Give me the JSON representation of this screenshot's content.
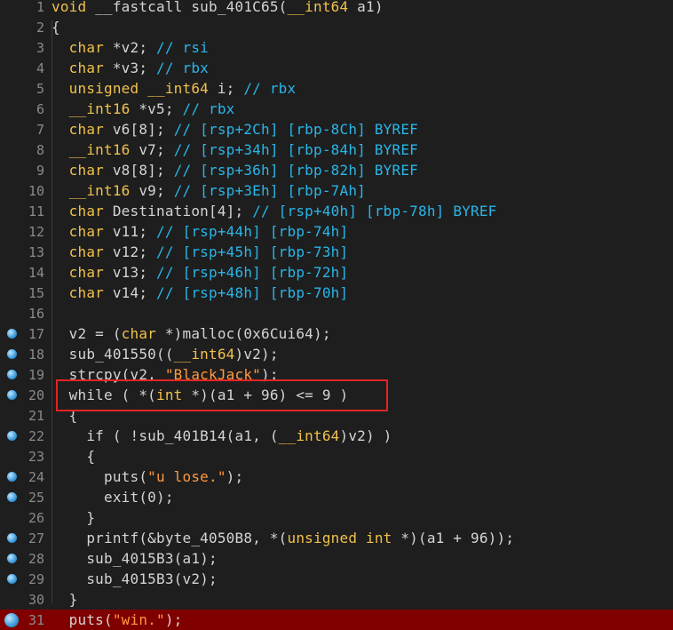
{
  "colors": {
    "background": "#1e1e1e",
    "line_number": "#8a8a8a",
    "type": "#f0c14b",
    "comment": "#29b6e8",
    "string": "#ff9940",
    "code": "#d4d4d4",
    "current_line": "#800000",
    "annotation_box": "#e32424",
    "breakpoint": "#3a9ad9"
  },
  "lines": [
    {
      "n": "1",
      "bp": false,
      "hl": false,
      "tokens": [
        [
          "ty",
          "void"
        ],
        [
          "pl",
          " __fastcall sub_401C65("
        ],
        [
          "ty",
          "__int64"
        ],
        [
          "pl",
          " a1)"
        ]
      ]
    },
    {
      "n": "2",
      "bp": false,
      "hl": false,
      "tokens": [
        [
          "pl",
          "{"
        ]
      ]
    },
    {
      "n": "3",
      "bp": false,
      "hl": false,
      "tokens": [
        [
          "pl",
          "  "
        ],
        [
          "ty",
          "char"
        ],
        [
          "pl",
          " *v2; "
        ],
        [
          "cm",
          "// rsi"
        ]
      ]
    },
    {
      "n": "4",
      "bp": false,
      "hl": false,
      "tokens": [
        [
          "pl",
          "  "
        ],
        [
          "ty",
          "char"
        ],
        [
          "pl",
          " *v3; "
        ],
        [
          "cm",
          "// rbx"
        ]
      ]
    },
    {
      "n": "5",
      "bp": false,
      "hl": false,
      "tokens": [
        [
          "pl",
          "  "
        ],
        [
          "ty",
          "unsigned __int64"
        ],
        [
          "pl",
          " i; "
        ],
        [
          "cm",
          "// rbx"
        ]
      ]
    },
    {
      "n": "6",
      "bp": false,
      "hl": false,
      "tokens": [
        [
          "pl",
          "  "
        ],
        [
          "ty",
          "__int16"
        ],
        [
          "pl",
          " *v5; "
        ],
        [
          "cm",
          "// rbx"
        ]
      ]
    },
    {
      "n": "7",
      "bp": false,
      "hl": false,
      "tokens": [
        [
          "pl",
          "  "
        ],
        [
          "ty",
          "char"
        ],
        [
          "pl",
          " v6[8]; "
        ],
        [
          "cm",
          "// [rsp+2Ch] [rbp-8Ch] BYREF"
        ]
      ]
    },
    {
      "n": "8",
      "bp": false,
      "hl": false,
      "tokens": [
        [
          "pl",
          "  "
        ],
        [
          "ty",
          "__int16"
        ],
        [
          "pl",
          " v7; "
        ],
        [
          "cm",
          "// [rsp+34h] [rbp-84h] BYREF"
        ]
      ]
    },
    {
      "n": "9",
      "bp": false,
      "hl": false,
      "tokens": [
        [
          "pl",
          "  "
        ],
        [
          "ty",
          "char"
        ],
        [
          "pl",
          " v8[8]; "
        ],
        [
          "cm",
          "// [rsp+36h] [rbp-82h] BYREF"
        ]
      ]
    },
    {
      "n": "10",
      "bp": false,
      "hl": false,
      "tokens": [
        [
          "pl",
          "  "
        ],
        [
          "ty",
          "__int16"
        ],
        [
          "pl",
          " v9; "
        ],
        [
          "cm",
          "// [rsp+3Eh] [rbp-7Ah]"
        ]
      ]
    },
    {
      "n": "11",
      "bp": false,
      "hl": false,
      "tokens": [
        [
          "pl",
          "  "
        ],
        [
          "ty",
          "char"
        ],
        [
          "pl",
          " Destination[4]; "
        ],
        [
          "cm",
          "// [rsp+40h] [rbp-78h] BYREF"
        ]
      ]
    },
    {
      "n": "12",
      "bp": false,
      "hl": false,
      "tokens": [
        [
          "pl",
          "  "
        ],
        [
          "ty",
          "char"
        ],
        [
          "pl",
          " v11; "
        ],
        [
          "cm",
          "// [rsp+44h] [rbp-74h]"
        ]
      ]
    },
    {
      "n": "13",
      "bp": false,
      "hl": false,
      "tokens": [
        [
          "pl",
          "  "
        ],
        [
          "ty",
          "char"
        ],
        [
          "pl",
          " v12; "
        ],
        [
          "cm",
          "// [rsp+45h] [rbp-73h]"
        ]
      ]
    },
    {
      "n": "14",
      "bp": false,
      "hl": false,
      "tokens": [
        [
          "pl",
          "  "
        ],
        [
          "ty",
          "char"
        ],
        [
          "pl",
          " v13; "
        ],
        [
          "cm",
          "// [rsp+46h] [rbp-72h]"
        ]
      ]
    },
    {
      "n": "15",
      "bp": false,
      "hl": false,
      "tokens": [
        [
          "pl",
          "  "
        ],
        [
          "ty",
          "char"
        ],
        [
          "pl",
          " v14; "
        ],
        [
          "cm",
          "// [rsp+48h] [rbp-70h]"
        ]
      ]
    },
    {
      "n": "16",
      "bp": false,
      "hl": false,
      "tokens": [
        [
          "pl",
          ""
        ]
      ]
    },
    {
      "n": "17",
      "bp": true,
      "hl": false,
      "tokens": [
        [
          "pl",
          "  v2 = ("
        ],
        [
          "ty",
          "char"
        ],
        [
          "pl",
          " *)malloc(0x6Cui64);"
        ]
      ]
    },
    {
      "n": "18",
      "bp": true,
      "hl": false,
      "tokens": [
        [
          "pl",
          "  sub_401550(("
        ],
        [
          "ty",
          "__int64"
        ],
        [
          "pl",
          ")v2);"
        ]
      ]
    },
    {
      "n": "19",
      "bp": true,
      "hl": false,
      "tokens": [
        [
          "pl",
          "  strcpy(v2, "
        ],
        [
          "st",
          "\"BlackJack\""
        ],
        [
          "pl",
          ");"
        ]
      ]
    },
    {
      "n": "20",
      "bp": true,
      "hl": false,
      "tokens": [
        [
          "pl",
          "  while ( *("
        ],
        [
          "ty",
          "int"
        ],
        [
          "pl",
          " *)(a1 + 96) <= 9 )"
        ]
      ]
    },
    {
      "n": "21",
      "bp": false,
      "hl": false,
      "tokens": [
        [
          "pl",
          "  {"
        ]
      ]
    },
    {
      "n": "22",
      "bp": true,
      "hl": false,
      "tokens": [
        [
          "pl",
          "    if ( !sub_401B14(a1, ("
        ],
        [
          "ty",
          "__int64"
        ],
        [
          "pl",
          ")v2) )"
        ]
      ]
    },
    {
      "n": "23",
      "bp": false,
      "hl": false,
      "tokens": [
        [
          "pl",
          "    {"
        ]
      ]
    },
    {
      "n": "24",
      "bp": true,
      "hl": false,
      "tokens": [
        [
          "pl",
          "      puts("
        ],
        [
          "st",
          "\"u lose.\""
        ],
        [
          "pl",
          ");"
        ]
      ]
    },
    {
      "n": "25",
      "bp": true,
      "hl": false,
      "tokens": [
        [
          "pl",
          "      exit(0);"
        ]
      ]
    },
    {
      "n": "26",
      "bp": false,
      "hl": false,
      "tokens": [
        [
          "pl",
          "    }"
        ]
      ]
    },
    {
      "n": "27",
      "bp": true,
      "hl": false,
      "tokens": [
        [
          "pl",
          "    printf(&byte_4050B8, *("
        ],
        [
          "ty",
          "unsigned int"
        ],
        [
          "pl",
          " *)(a1 + 96));"
        ]
      ]
    },
    {
      "n": "28",
      "bp": true,
      "hl": false,
      "tokens": [
        [
          "pl",
          "    sub_4015B3(a1);"
        ]
      ]
    },
    {
      "n": "29",
      "bp": true,
      "hl": false,
      "tokens": [
        [
          "pl",
          "    sub_4015B3(v2);"
        ]
      ]
    },
    {
      "n": "30",
      "bp": false,
      "hl": false,
      "tokens": [
        [
          "pl",
          "  }"
        ]
      ]
    },
    {
      "n": "31",
      "bp": true,
      "hl": true,
      "tokens": [
        [
          "pl",
          "  puts("
        ],
        [
          "st",
          "\"win.\""
        ],
        [
          "pl",
          ");"
        ]
      ]
    }
  ]
}
